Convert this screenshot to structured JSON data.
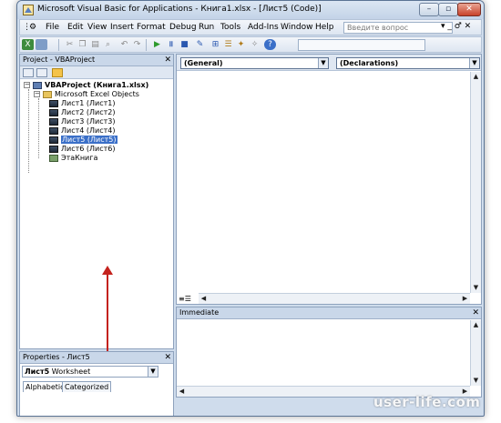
{
  "window": {
    "title": "Microsoft Visual Basic for Applications - Книга1.xlsx - [Лист5 (Code)]",
    "min_label": "–",
    "max_label": "▫",
    "close_label": "✕"
  },
  "menubar": {
    "items": [
      {
        "label": "File"
      },
      {
        "label": "Edit"
      },
      {
        "label": "View"
      },
      {
        "label": "Insert"
      },
      {
        "label": "Format"
      },
      {
        "label": "Debug"
      },
      {
        "label": "Run"
      },
      {
        "label": "Tools"
      },
      {
        "label": "Add-Ins"
      },
      {
        "label": "Window"
      },
      {
        "label": "Help"
      }
    ],
    "help_placeholder": "Введите вопрос",
    "mdi_controls": "▾ _ ♂ ✕"
  },
  "project": {
    "title": "Project - VBAProject",
    "close_label": "✕",
    "root": "VBAProject (Книга1.xlsx)",
    "folder": "Microsoft Excel Objects",
    "sheets": [
      "Лист1 (Лист1)",
      "Лист2 (Лист2)",
      "Лист3 (Лист3)",
      "Лист4 (Лист4)",
      "Лист5 (Лист5)",
      "Лист6 (Лист6)"
    ],
    "selected_sheet_index": 4,
    "workbook": "ЭтаКнига"
  },
  "properties": {
    "title": "Properties - Лист5",
    "close_label": "✕",
    "object_name": "Лист5",
    "object_type": "Worksheet",
    "tabs": [
      "Alphabetic",
      "Categorized"
    ]
  },
  "code": {
    "object_combo": "(General)",
    "proc_combo": "(Declarations)"
  },
  "immediate": {
    "title": "Immediate",
    "close_label": "✕"
  },
  "watermark": "user-life.com",
  "colors": {
    "selection": "#3a6fc8",
    "annotation_arrow": "#c4221d"
  }
}
